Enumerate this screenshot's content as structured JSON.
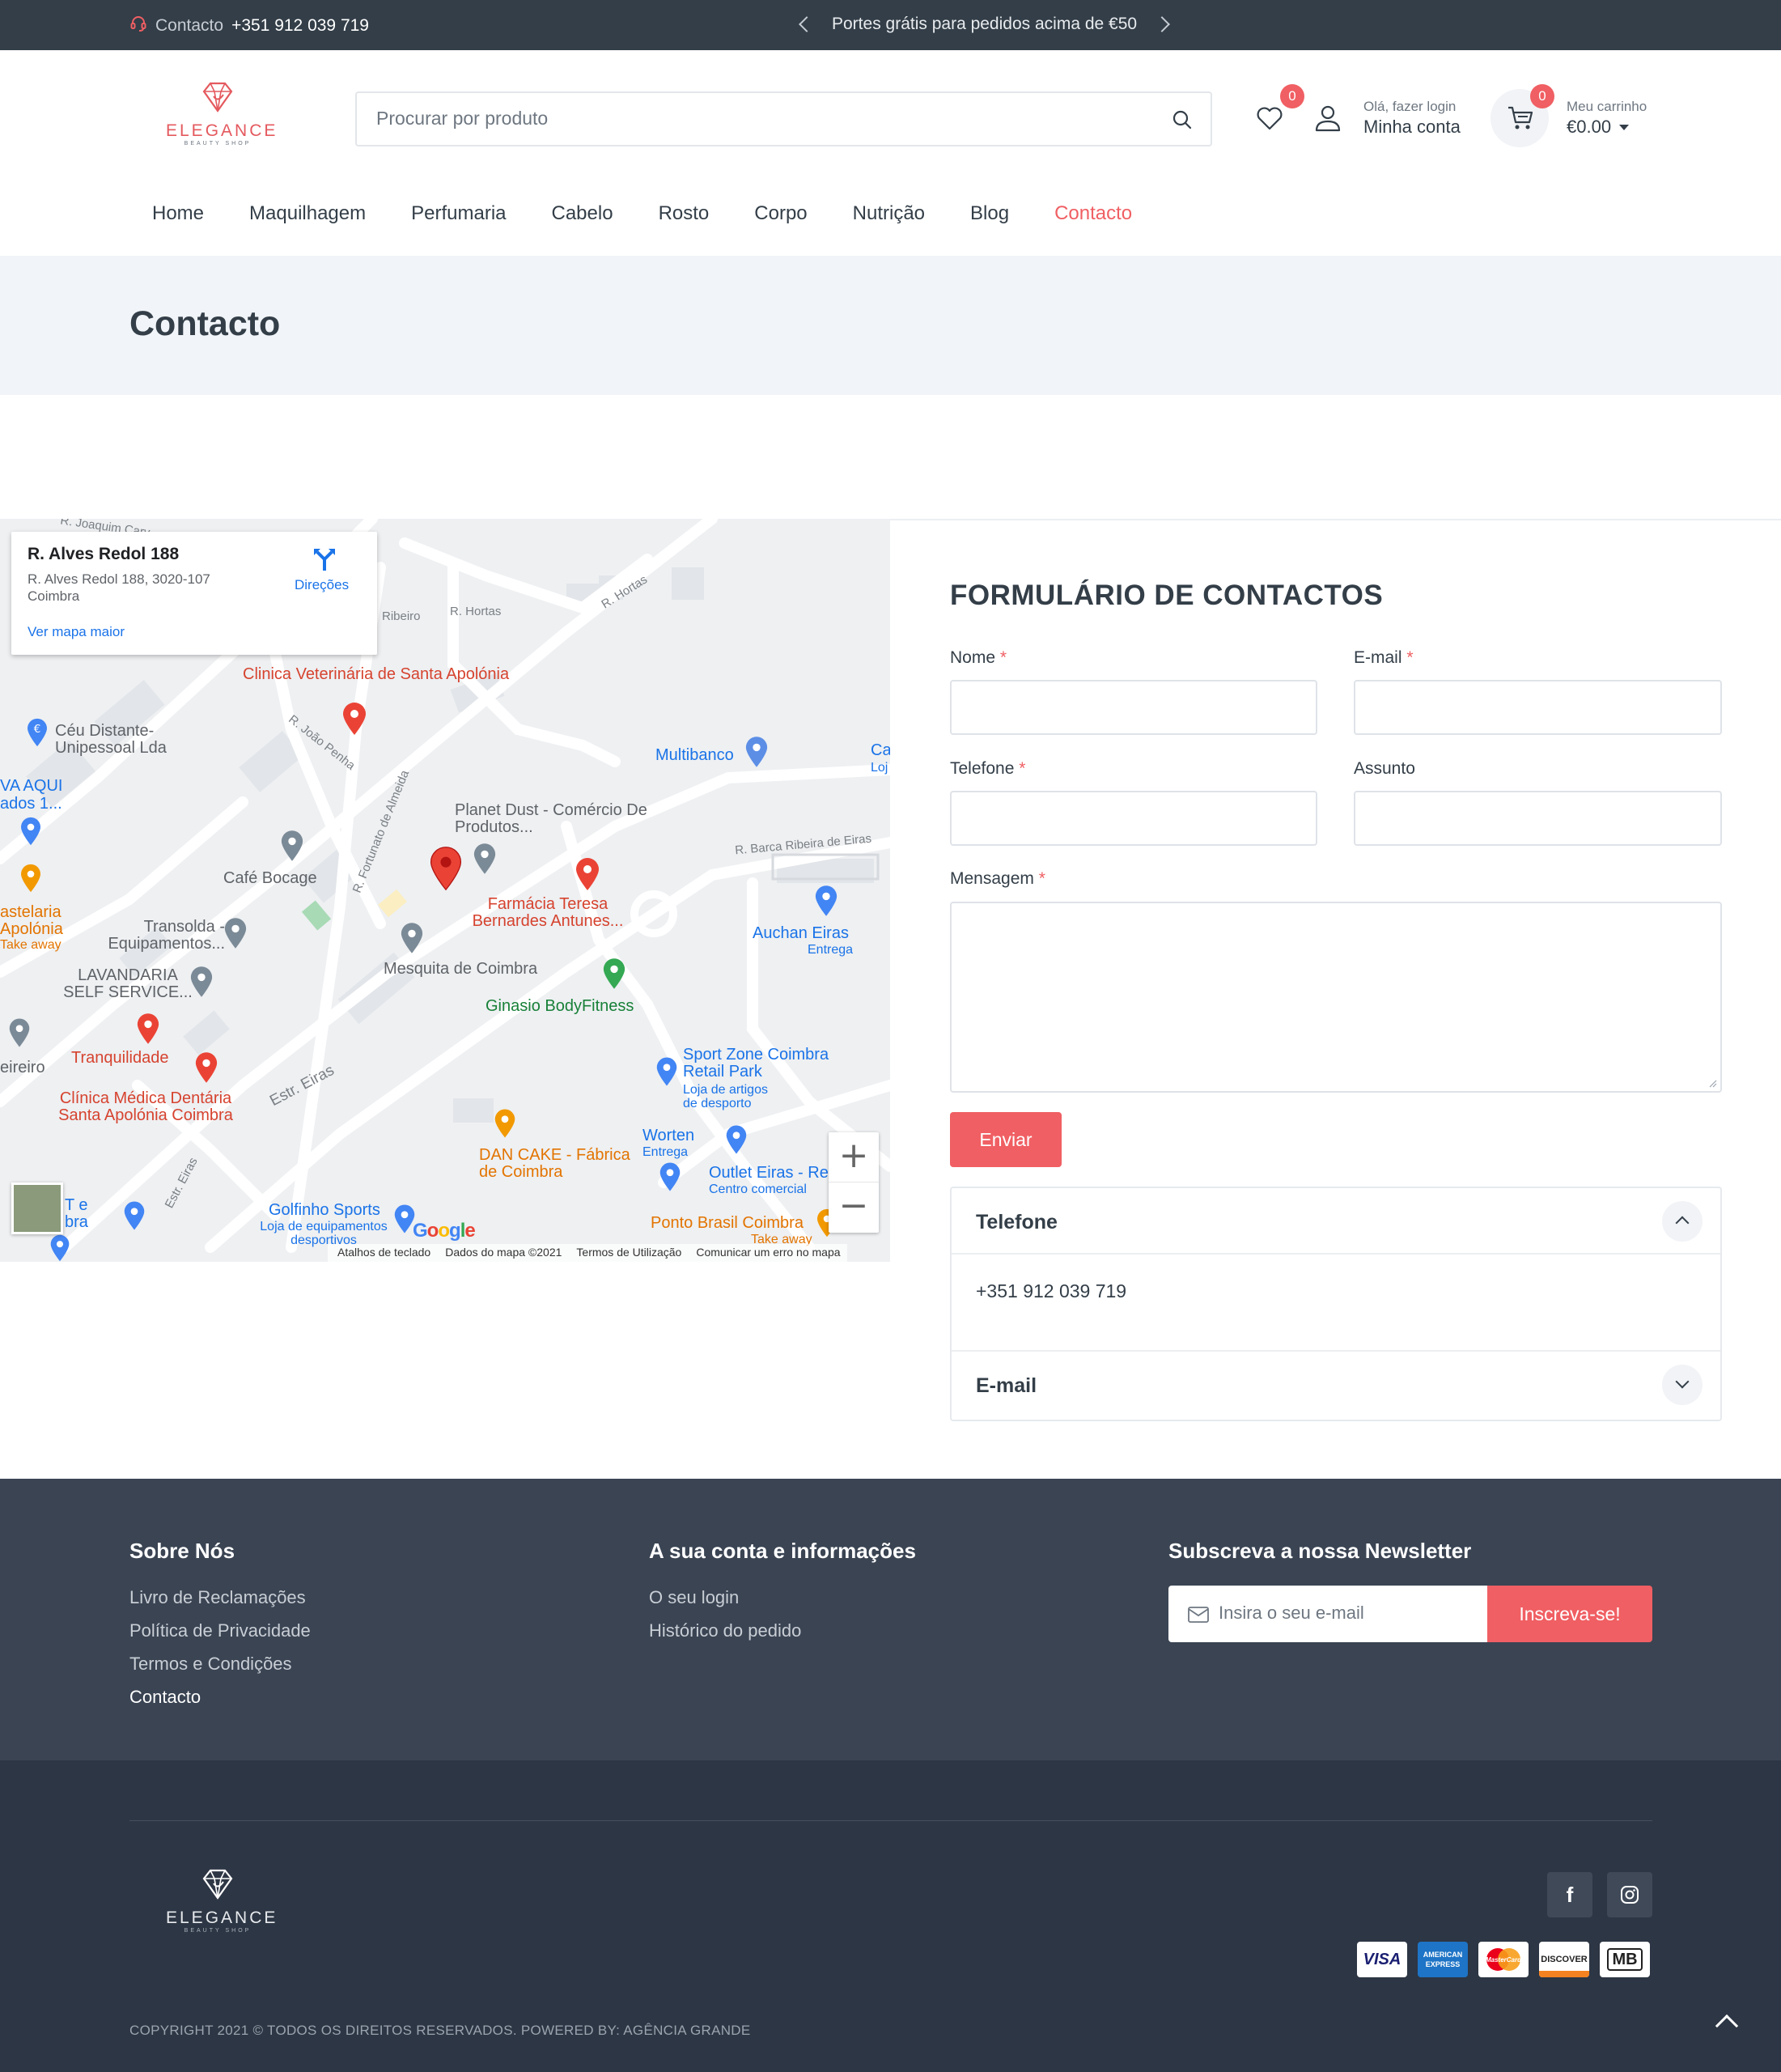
{
  "topbar": {
    "contact_label": "Contacto",
    "contact_number": "+351 912 039 719",
    "promo": "Portes grátis para pedidos acima de €50"
  },
  "header": {
    "logo_text": "ELEGANCE",
    "logo_subtext": "BEAUTY SHOP",
    "search_placeholder": "Procurar por produto",
    "wishlist_count": "0",
    "account_greeting": "Olá, fazer login",
    "account_label": "Minha conta",
    "cart_count": "0",
    "cart_label": "Meu carrinho",
    "cart_total": "€0.00"
  },
  "nav": {
    "items": [
      "Home",
      "Maquilhagem",
      "Perfumaria",
      "Cabelo",
      "Rosto",
      "Corpo",
      "Nutrição",
      "Blog",
      "Contacto"
    ],
    "active": "Contacto"
  },
  "page": {
    "title": "Contacto"
  },
  "map": {
    "card_title": "R. Alves Redol 188",
    "card_address": "R. Alves Redol 188, 3020-107 Coimbra",
    "card_link": "Ver mapa maior",
    "directions": "Direções",
    "places": {
      "clinica_vet": "Clinica Veterinária de Santa Apolónia",
      "ceu": "Céu Distante- Unipessoal Lda",
      "va_aqui": "VA AQUI",
      "ados": "ados 1...",
      "multibanco": "Multibanco",
      "planet_dust": "Planet Dust - Comércio De Produtos...",
      "cafe_bocage": "Café Bocage",
      "farmacia": "Farmácia Teresa Bernardes Antunes...",
      "transolda": "Transolda - Equipamentos...",
      "astelaria": "astelaria",
      "apolonia": "Apolónia",
      "take_away": "Take away",
      "mesquita": "Mesquita de Coimbra",
      "auchan": "Auchan Eiras",
      "auchan_sub": "Entrega",
      "lavandaria": "LAVANDARIA SELF SERVICE...",
      "ginasio": "Ginasio BodyFitness",
      "tranquilidade": "Tranquilidade",
      "eireiro": "eireiro",
      "sport_zone": "Sport Zone Coimbra Retail Park",
      "sport_zone_sub": "Loja de artigos de desporto",
      "clinica_med": "Clínica Médica Dentária Santa Apolónia Coimbra",
      "worten": "Worten",
      "worten_sub": "Entrega",
      "dan_cake": "DAN CAKE - Fábrica de Coimbra",
      "outlet": "Outlet Eiras - Re",
      "outlet_sub": "Centro comercial",
      "golfinho": "Golfinho Sports",
      "golfinho_sub": "Loja de equipamentos desportivos",
      "ponto_brasil": "Ponto Brasil Coimbra",
      "ponto_sub": "Take away",
      "ca": "Ca",
      "loj": "Loj",
      "te": "T e",
      "bra": "bra"
    },
    "streets": {
      "joaquim": "R. Joaquim Carv...",
      "ribeiro": "Ribeiro",
      "hortas1": "R. Hortas",
      "hortas2": "R. Hortas",
      "joao_penha": "R. João Penha",
      "fortunato": "R. Fortunato de Almeida",
      "barca": "R. Barca Ribeira de Eiras",
      "estr1": "Estr. Eiras",
      "estr2": "Estr. Eiras"
    },
    "google": "Google",
    "attribution": [
      "Atalhos de teclado",
      "Dados do mapa ©2021",
      "Termos de Utilização",
      "Comunicar um erro no mapa"
    ]
  },
  "form": {
    "title": "FORMULÁRIO DE CONTACTOS",
    "name_label": "Nome",
    "email_label": "E-mail",
    "phone_label": "Telefone",
    "subject_label": "Assunto",
    "message_label": "Mensagem",
    "required_mark": "*",
    "submit": "Enviar"
  },
  "accordion": {
    "phone_title": "Telefone",
    "phone_value": "+351 912 039 719",
    "email_title": "E-mail"
  },
  "footer": {
    "about_title": "Sobre Nós",
    "about_links": [
      "Livro de Reclamações",
      "Política de Privacidade",
      "Termos e Condições",
      "Contacto"
    ],
    "account_title": "A sua conta e informações",
    "account_links": [
      "O seu login",
      "Histórico do pedido"
    ],
    "newsletter_title": "Subscreva a nossa Newsletter",
    "newsletter_placeholder": "Insira o seu e-mail",
    "newsletter_button": "Inscreva-se!",
    "logo_text": "ELEGANCE",
    "logo_subtext": "BEAUTY SHOP",
    "social": [
      "f"
    ],
    "payments": [
      "VISA",
      "AMERICAN EXPRESS",
      "MasterCard",
      "DISCOVER",
      "MB"
    ],
    "copyright": "COPYRIGHT 2021 © TODOS OS DIREITOS RESERVADOS. POWERED BY: AGÊNCIA GRANDE"
  },
  "colors": {
    "accent": "#f05f63",
    "topbar": "#333e48",
    "footer_top": "#3a4453",
    "footer_bottom": "#2d3644",
    "page_title_bg": "#f1f4f8"
  }
}
